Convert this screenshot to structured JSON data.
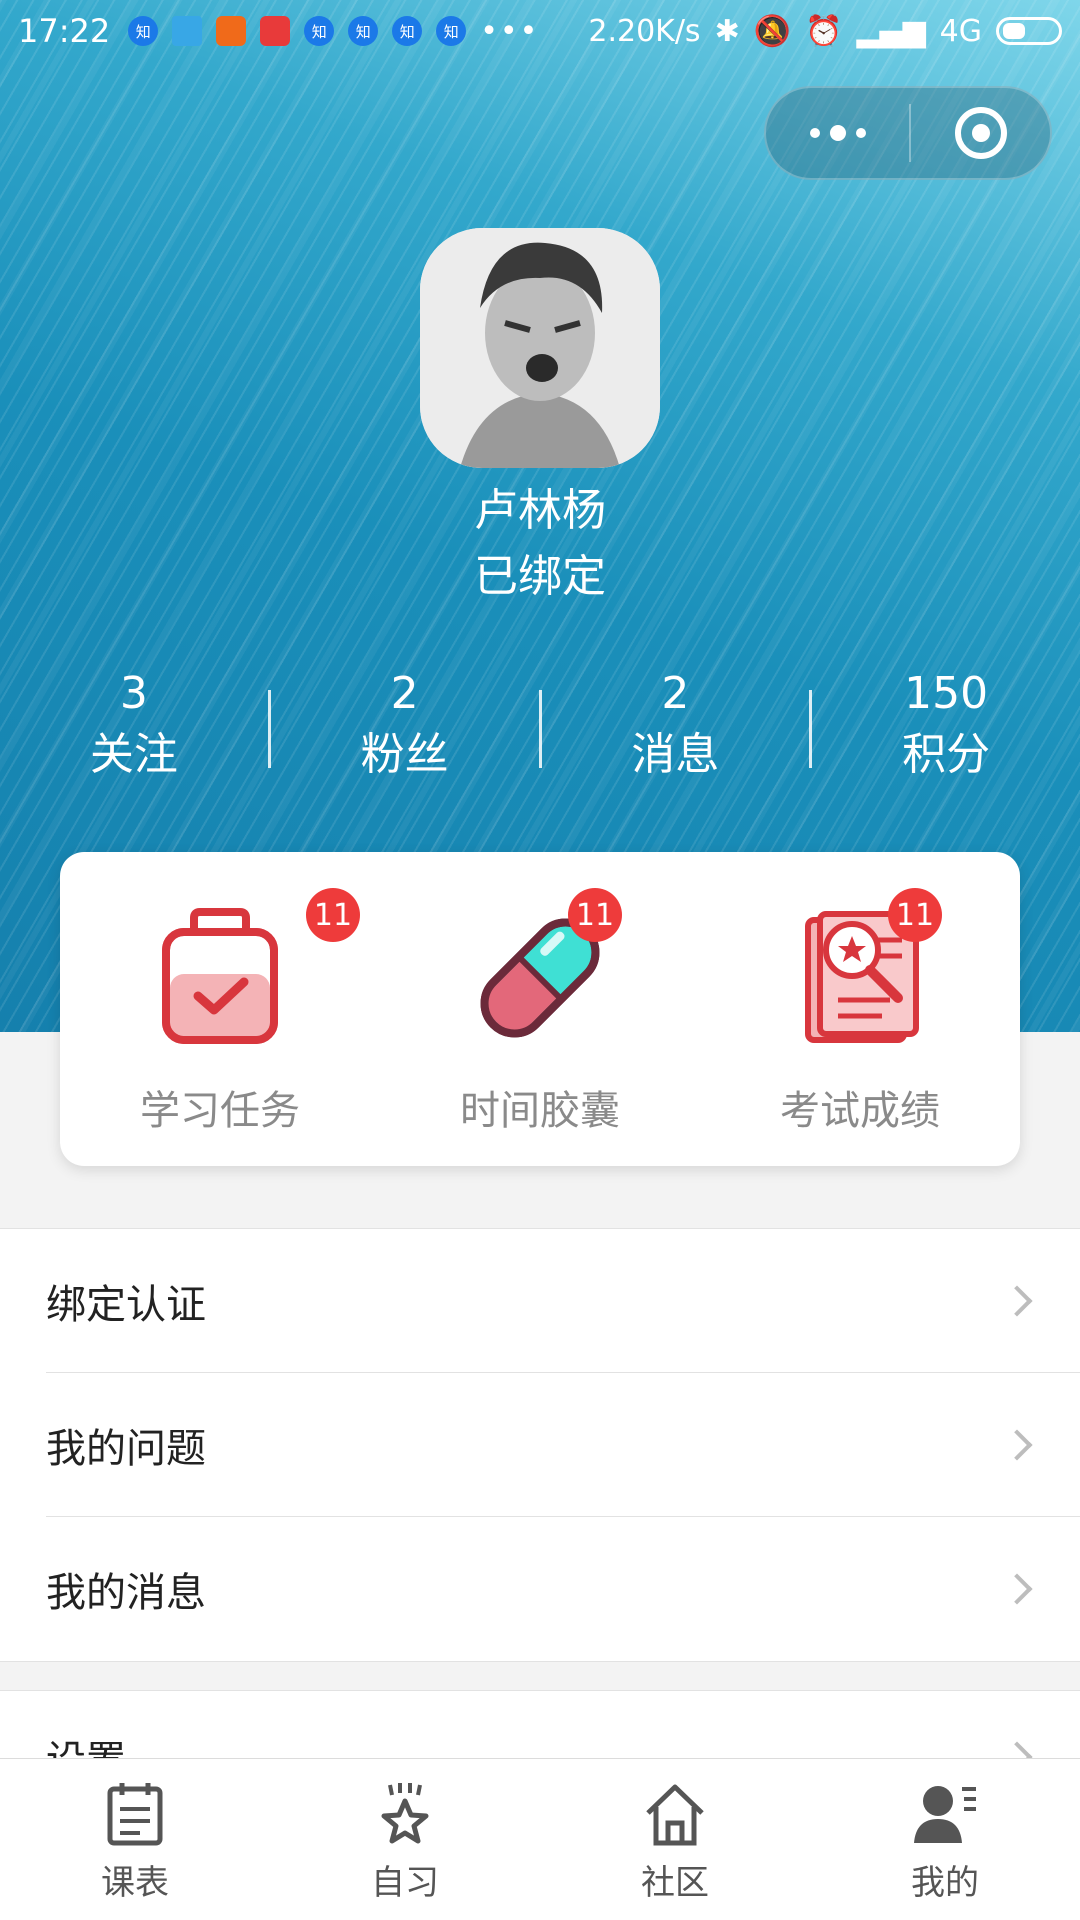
{
  "status_bar": {
    "time": "17:22",
    "notification_icons": [
      "知",
      "mail-icon",
      "weibo",
      "app",
      "知",
      "知",
      "知",
      "知"
    ],
    "more": "•••",
    "net_speed": "2.20K/s",
    "network": "4G"
  },
  "profile": {
    "name": "卢林杨",
    "bind_status": "已绑定"
  },
  "stats": [
    {
      "value": "3",
      "label": "关注"
    },
    {
      "value": "2",
      "label": "粉丝"
    },
    {
      "value": "2",
      "label": "消息"
    },
    {
      "value": "150",
      "label": "积分"
    }
  ],
  "cards": [
    {
      "label": "学习任务",
      "badge": "11",
      "icon": "clipboard-check-icon"
    },
    {
      "label": "时间胶囊",
      "badge": "11",
      "icon": "capsule-pill-icon"
    },
    {
      "label": "考试成绩",
      "badge": "11",
      "icon": "report-search-icon"
    }
  ],
  "menu": [
    {
      "label": "绑定认证"
    },
    {
      "label": "我的问题"
    },
    {
      "label": "我的消息"
    }
  ],
  "menu_partial": {
    "label": "设置"
  },
  "tabs": [
    {
      "label": "课表",
      "icon": "calendar-icon"
    },
    {
      "label": "自习",
      "icon": "star-icon"
    },
    {
      "label": "社区",
      "icon": "home-icon"
    },
    {
      "label": "我的",
      "icon": "user-icon"
    }
  ],
  "colors": {
    "accent_red": "#ee3b3b",
    "header_blue": "#1a8fba",
    "icon_pink": "#f4b3b6",
    "icon_red": "#d8363d",
    "icon_teal": "#3fe0d4"
  }
}
